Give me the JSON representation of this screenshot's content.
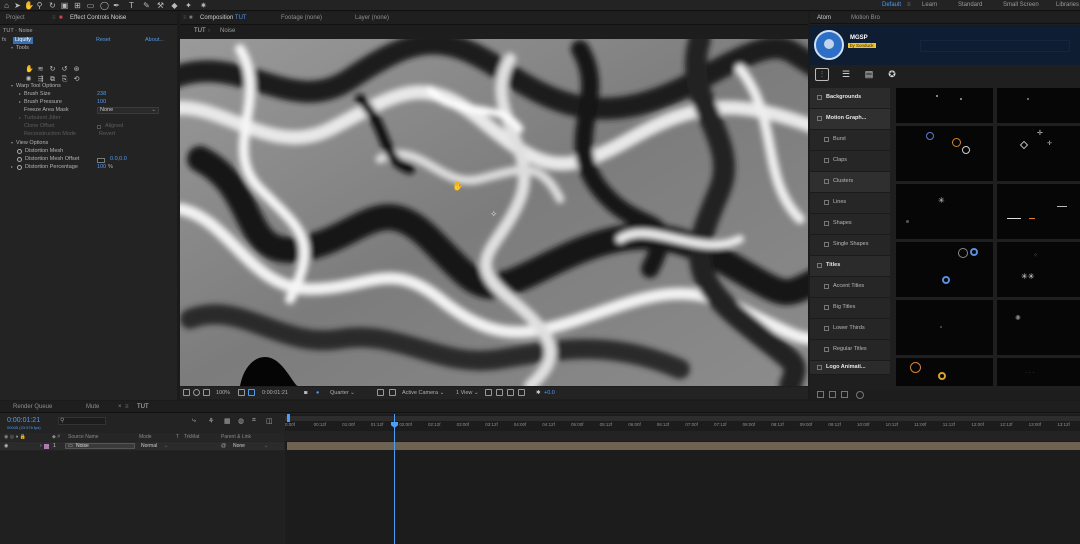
{
  "app": {
    "workspaces": [
      "Default",
      "Learn",
      "Standard",
      "Small Screen",
      "Libraries"
    ],
    "active_workspace": "Default"
  },
  "project_panel": {
    "tab_project": "Project",
    "tab_effect_controls": "Effect Controls",
    "effect_controls_target": "Noise",
    "breadcrumb": "TUT · Noise",
    "effect": {
      "name": "Liquify",
      "reset_label": "Reset",
      "about_label": "About...",
      "tools_label": "Tools",
      "warp_tool_options_label": "Warp Tool Options",
      "brush_size_label": "Brush Size",
      "brush_size_value": "238",
      "brush_pressure_label": "Brush Pressure",
      "brush_pressure_value": "100",
      "freeze_area_mask_label": "Freeze Area Mask",
      "freeze_area_mask_value": "None",
      "turbulent_jitter_label": "Turbulent Jitter",
      "clone_offset_label": "Clone Offset",
      "aligned_label": "Aligned",
      "reconstruction_mode_label": "Reconstruction Mode",
      "reconstruction_mode_value": "Revert",
      "view_options_label": "View Options",
      "distortion_mesh_label": "Distortion Mesh",
      "distortion_mesh_offset_label": "Distortion Mesh Offset",
      "distortion_mesh_offset_value": "0.0,0.0",
      "distortion_percentage_label": "Distortion Percentage",
      "distortion_percentage_value": "100",
      "distortion_percentage_unit": "%"
    }
  },
  "composition_panel": {
    "tab_composition": "Composition",
    "composition_name": "TUT",
    "tab_footage": "Footage (none)",
    "tab_layer": "Layer (none)",
    "breadcrumb": [
      "TUT",
      "Noise"
    ],
    "footer": {
      "zoom": "100%",
      "timecode": "0:00:01:21",
      "resolution": "Quarter",
      "camera": "Active Camera",
      "views": "1 View",
      "exposure": "+0.0"
    }
  },
  "atom_panel": {
    "tab_atom": "Atom",
    "tab_motion_bro": "Motion Bro",
    "banner_title": "MGSP",
    "banner_sub": "by Sonduck",
    "categories": [
      {
        "label": "Backgrounds",
        "kind": "head"
      },
      {
        "label": "Motion Graph...",
        "kind": "head"
      },
      {
        "label": "Burst",
        "kind": "sub"
      },
      {
        "label": "Claps",
        "kind": "sub"
      },
      {
        "label": "Clusters",
        "kind": "sub"
      },
      {
        "label": "Lines",
        "kind": "sub"
      },
      {
        "label": "Shapes",
        "kind": "sub"
      },
      {
        "label": "Single Shapes",
        "kind": "sub"
      },
      {
        "label": "Titles",
        "kind": "head"
      },
      {
        "label": "Accent Titles",
        "kind": "sub"
      },
      {
        "label": "Big Titles",
        "kind": "sub"
      },
      {
        "label": "Lower Thirds",
        "kind": "sub"
      },
      {
        "label": "Regular Titles",
        "kind": "sub"
      },
      {
        "label": "Logo Animati...",
        "kind": "head"
      }
    ]
  },
  "timeline": {
    "tab_render_queue": "Render Queue",
    "tab_mute": "Mute",
    "tab_tut": "TUT",
    "current_time": "0:00:01:21",
    "fps_info": "00045 (23.976 fps)",
    "columns": {
      "source_name": "Source Name",
      "mode": "Mode",
      "t": "T",
      "trkmat": "TrkMat",
      "parent": "Parent & Link"
    },
    "layer": {
      "index": "1",
      "name": "Noise",
      "mode": "Normal",
      "parent": "None"
    },
    "ruler_ticks": [
      "0:00f",
      "00:12f",
      "01:00f",
      "01:12f",
      "02:00f",
      "02:12f",
      "03:00f",
      "03:12f",
      "04:00f",
      "04:12f",
      "05:00f",
      "05:12f",
      "06:00f",
      "06:12f",
      "07:00f",
      "07:12f",
      "08:00f",
      "08:12f",
      "09:00f",
      "09:12f",
      "10:00f",
      "10:12f",
      "11:00f",
      "11:12f",
      "12:00f",
      "12:12f",
      "13:00f",
      "13:12f"
    ]
  },
  "colors": {
    "accent": "#4d9cf7",
    "panel": "#232323",
    "background": "#1b1b1b"
  }
}
